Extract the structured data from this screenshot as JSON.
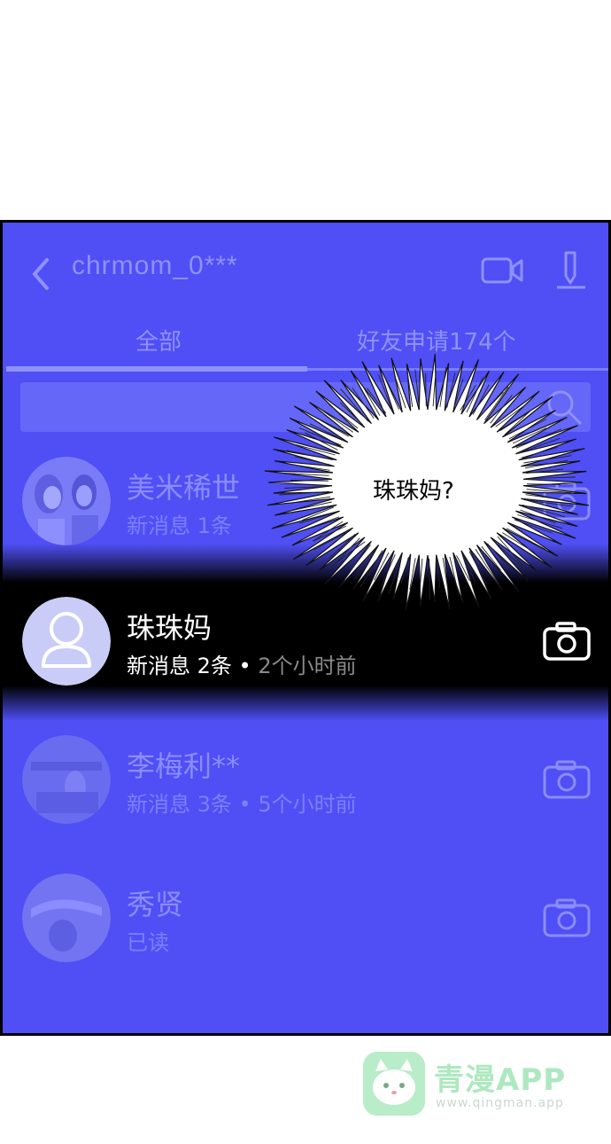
{
  "header": {
    "title": "chrmom_0***",
    "back_icon": "chevron-left-icon",
    "video_icon": "video-camera-icon",
    "edit_icon": "pen-icon"
  },
  "tabs": [
    {
      "label": "全部",
      "active": true
    },
    {
      "label": "好友申请174个",
      "active": false
    }
  ],
  "search": {
    "icon": "search-icon"
  },
  "messages": [
    {
      "name": "美米稀世",
      "meta": "新消息 1条",
      "time": "",
      "highlighted": false
    },
    {
      "name": "珠珠妈",
      "meta": "新消息 2条 • ",
      "time": "2个小时前",
      "highlighted": true
    },
    {
      "name": "李梅利**",
      "meta": "新消息 3条 • ",
      "time": "5个小时前",
      "highlighted": false
    },
    {
      "name": "秀贤",
      "meta": "已读",
      "time": "",
      "highlighted": false
    }
  ],
  "speech_bubble": {
    "text": "珠珠妈?"
  },
  "watermark": {
    "name": "青漫APP",
    "url": "www.qingman.app"
  },
  "colors": {
    "panel": "#4f4ff5",
    "muted_text": "#8f91ff",
    "highlight": "#000000"
  }
}
